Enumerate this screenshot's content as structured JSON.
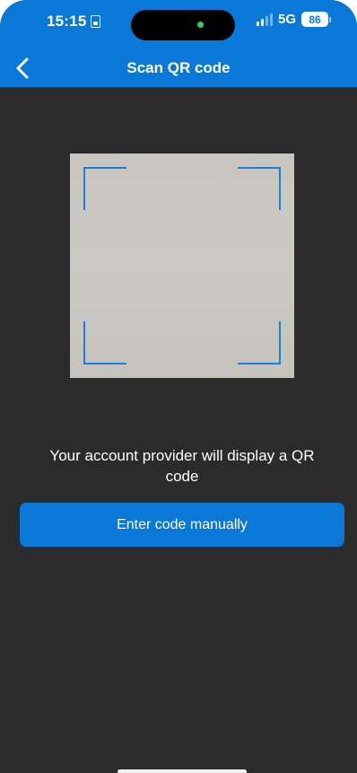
{
  "status_bar": {
    "time": "15:15",
    "network": "5G",
    "battery": "86"
  },
  "nav": {
    "title": "Scan QR code",
    "back_icon": "chevron-left-icon"
  },
  "instruction": "Your account provider will display a QR code",
  "manual_button_label": "Enter code manually",
  "colors": {
    "accent": "#0a78d7",
    "background": "#2b2b2b",
    "frame": "#1f7de0"
  }
}
